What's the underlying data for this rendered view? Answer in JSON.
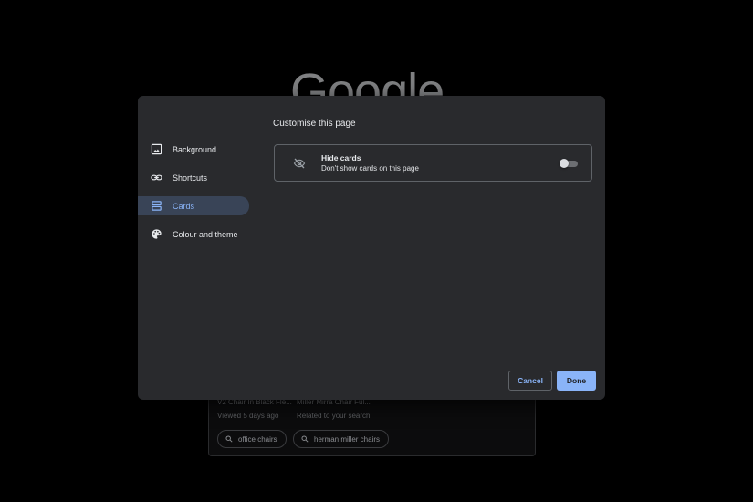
{
  "background": {
    "logo_text": "Google",
    "cards": [
      {
        "title": "V2 Chair In Black Fle...",
        "meta": "Viewed 5 days ago"
      },
      {
        "title": "Miller Mirra Chair Ful...",
        "meta": "Related to your search"
      }
    ],
    "chips": [
      {
        "label": "office chairs",
        "icon": "search-icon"
      },
      {
        "label": "herman miller chairs",
        "icon": "search-icon"
      }
    ]
  },
  "dialog": {
    "title": "Customise this page",
    "nav": [
      {
        "label": "Background",
        "icon": "image-icon",
        "active": false
      },
      {
        "label": "Shortcuts",
        "icon": "link-icon",
        "active": false
      },
      {
        "label": "Cards",
        "icon": "cards-icon",
        "active": true
      },
      {
        "label": "Colour and theme",
        "icon": "palette-icon",
        "active": false
      }
    ],
    "option": {
      "icon": "eye-off-icon",
      "title": "Hide cards",
      "description": "Don't show cards on this page",
      "enabled": false
    },
    "buttons": {
      "cancel": "Cancel",
      "done": "Done"
    }
  },
  "colors": {
    "dialog_bg": "#292a2d",
    "accent": "#8ab4f8",
    "active_nav_bg": "#394457",
    "page_bg": "#000000"
  }
}
